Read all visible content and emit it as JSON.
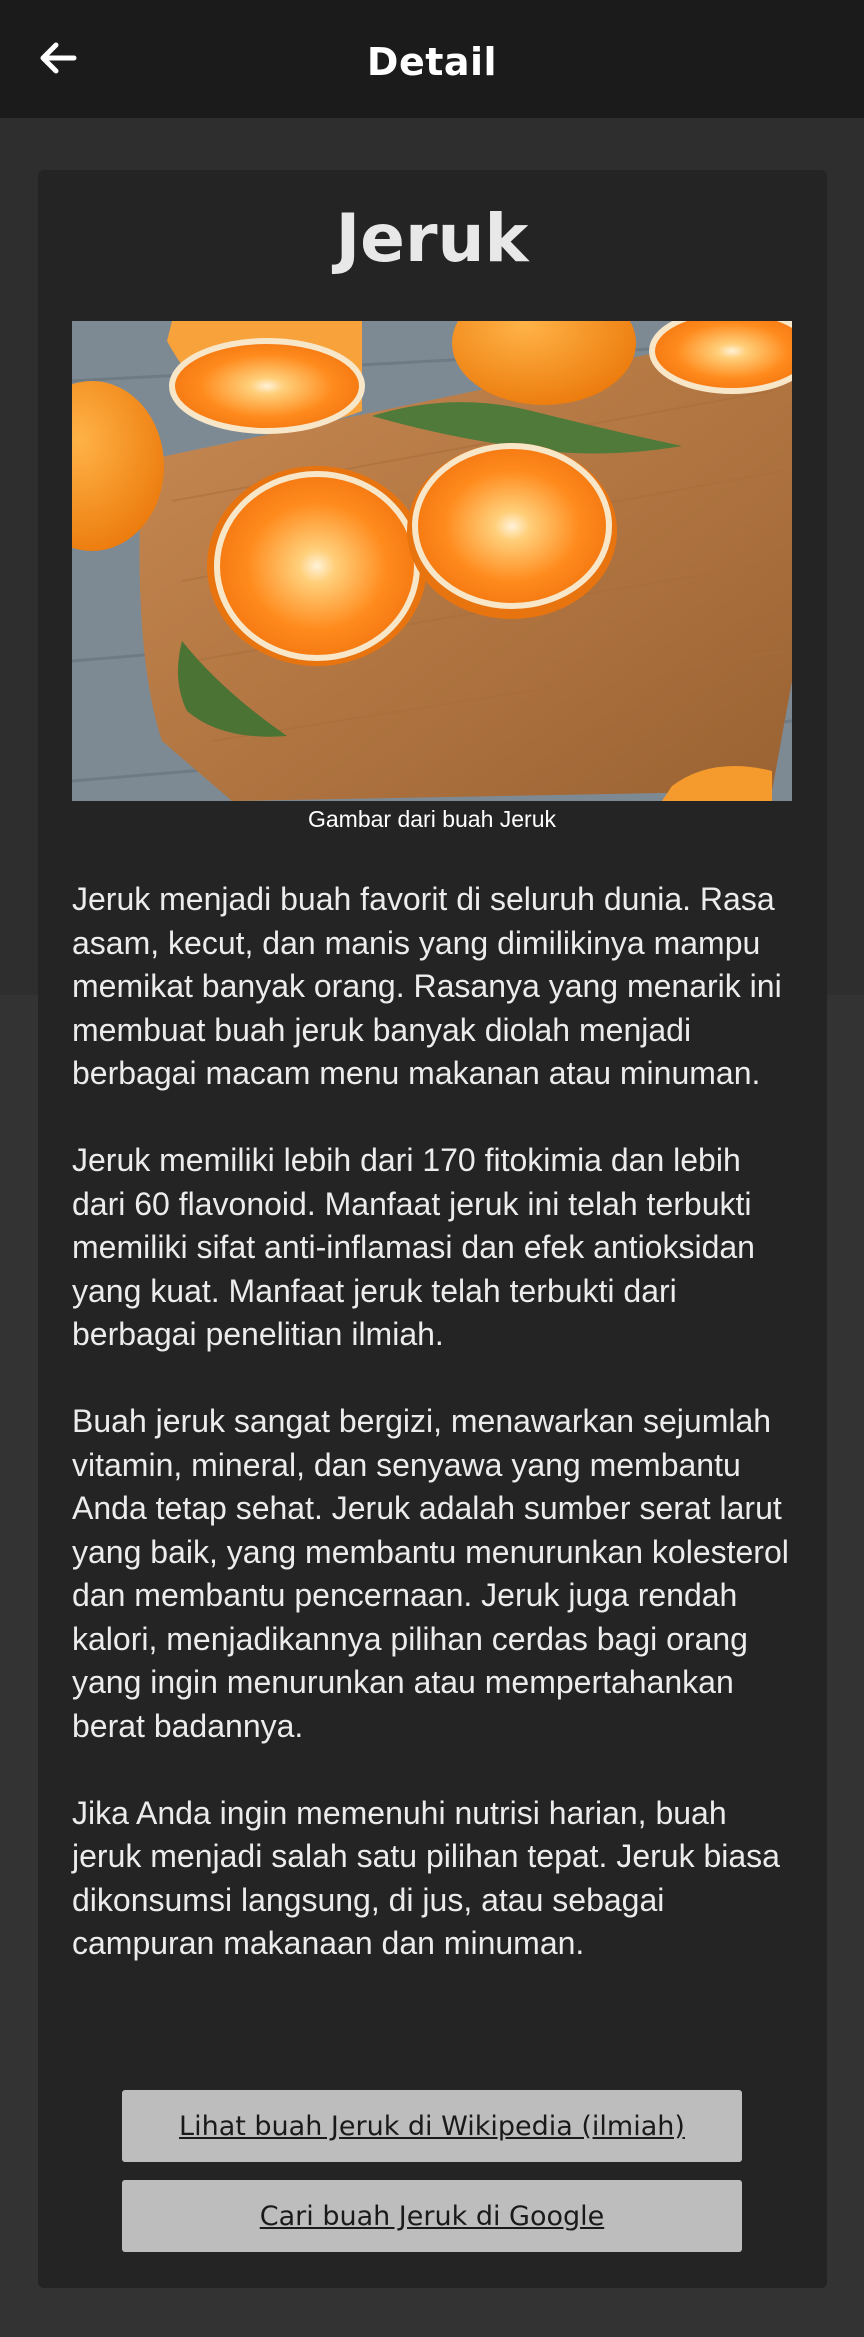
{
  "app_bar": {
    "title": "Detail",
    "back_icon": "arrow-left-icon"
  },
  "content": {
    "fruit_name": "Jeruk",
    "image_caption": "Gambar dari buah Jeruk",
    "image_subject": "oranges-on-cutting-board-photo",
    "description": "Jeruk menjadi buah favorit di seluruh dunia. Rasa asam, kecut, dan manis yang dimilikinya mampu memikat banyak orang. Rasanya yang menarik ini membuat buah jeruk banyak diolah menjadi berbagai macam menu makanan atau minuman.\n\n Jeruk memiliki lebih dari 170 fitokimia dan lebih dari 60 flavonoid. Manfaat jeruk ini telah terbukti memiliki sifat anti-inflamasi dan efek antioksidan yang kuat. Manfaat jeruk telah terbukti dari berbagai penelitian ilmiah.\n\n Buah jeruk sangat bergizi, menawarkan sejumlah vitamin, mineral, dan senyawa yang membantu Anda tetap sehat. Jeruk adalah sumber serat larut yang baik, yang membantu menurunkan kolesterol dan membantu pencernaan. Jeruk juga rendah kalori, menjadikannya pilihan cerdas bagi orang yang ingin menurunkan atau mempertahankan berat badannya.\n\n Jika Anda ingin memenuhi nutrisi harian, buah jeruk menjadi salah satu pilihan tepat. Jeruk biasa dikonsumsi langsung, di jus, atau sebagai campuran makanaan dan minuman."
  },
  "buttons": {
    "wikipedia": "Lihat buah Jeruk di Wikipedia (ilmiah)",
    "google": "Cari buah Jeruk di Google"
  },
  "colors": {
    "app_bar": "#1b1b1b",
    "background": "#2e2e2e",
    "card": "#242424",
    "button": "#bdbdbd",
    "orange": "#f7921e"
  }
}
